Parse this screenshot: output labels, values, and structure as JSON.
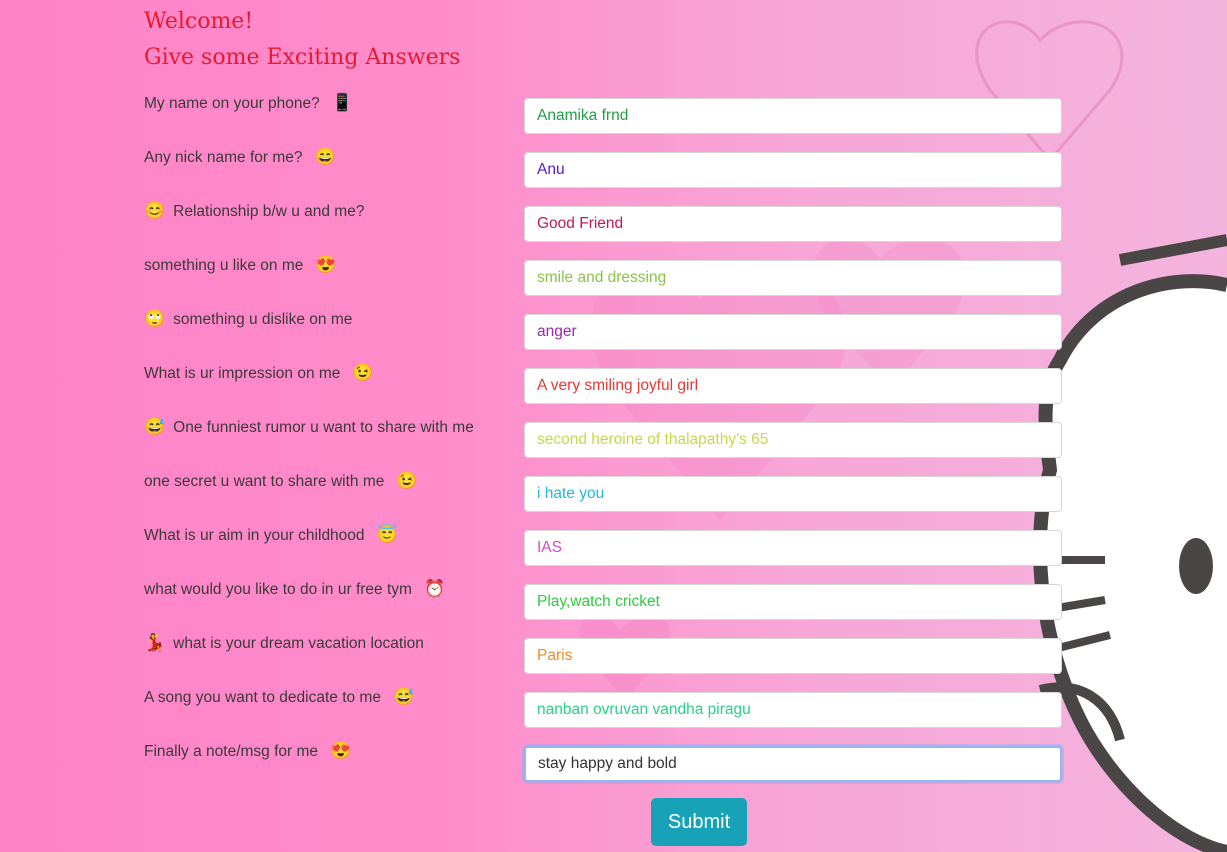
{
  "header": {
    "line1": "Welcome!",
    "line2": "Give some Exciting Answers"
  },
  "questions": [
    {
      "pre": "",
      "text": "My name on your phone?",
      "post": "📱",
      "answer": "Anamika frnd",
      "color": "#21a045"
    },
    {
      "pre": "",
      "text": "Any nick name for me?",
      "post": "😄",
      "answer": "Anu",
      "color": "#5a18c8"
    },
    {
      "pre": "😊",
      "text": "Relationship b/w u and me?",
      "post": "",
      "answer": "Good Friend",
      "color": "#c2185b"
    },
    {
      "pre": "",
      "text": "something u like on me",
      "post": "😍",
      "answer": "smile and dressing",
      "color": "#8bc34a"
    },
    {
      "pre": "🙄",
      "text": "something u dislike on me",
      "post": "",
      "answer": "anger",
      "color": "#9c27b0"
    },
    {
      "pre": "",
      "text": "What is ur impression on me",
      "post": "😉",
      "answer": "A very smiling joyful girl",
      "color": "#e53935"
    },
    {
      "pre": "😅",
      "text": "One funniest rumor u want to share with me",
      "post": "",
      "answer": "second heroine of thalapathy's 65",
      "color": "#c6d84c"
    },
    {
      "pre": "",
      "text": "one secret u want to share with me",
      "post": "😉",
      "answer": "i hate you",
      "color": "#26b8d8"
    },
    {
      "pre": "",
      "text": "What is ur aim in your childhood",
      "post": "😇",
      "answer": "IAS",
      "color": "#d24bc9"
    },
    {
      "pre": "",
      "text": "what would you like to do in ur free tym",
      "post": "⏰",
      "answer": "Play,watch cricket",
      "color": "#2ecc40"
    },
    {
      "pre": "💃",
      "text": "what is your dream vacation location",
      "post": "",
      "answer": "Paris",
      "color": "#f08a24"
    },
    {
      "pre": "",
      "text": "A song you want to dedicate to me",
      "post": "😅",
      "answer": "nanban ovruvan vandha piragu",
      "color": "#2bd08a"
    },
    {
      "pre": "",
      "text": "Finally a note/msg for me",
      "post": "😍",
      "answer": "stay happy and bold",
      "color": "#333333"
    }
  ],
  "submit_label": "Submit",
  "colors": {
    "header": "#e8192c",
    "submit_bg": "#17a2b8"
  }
}
